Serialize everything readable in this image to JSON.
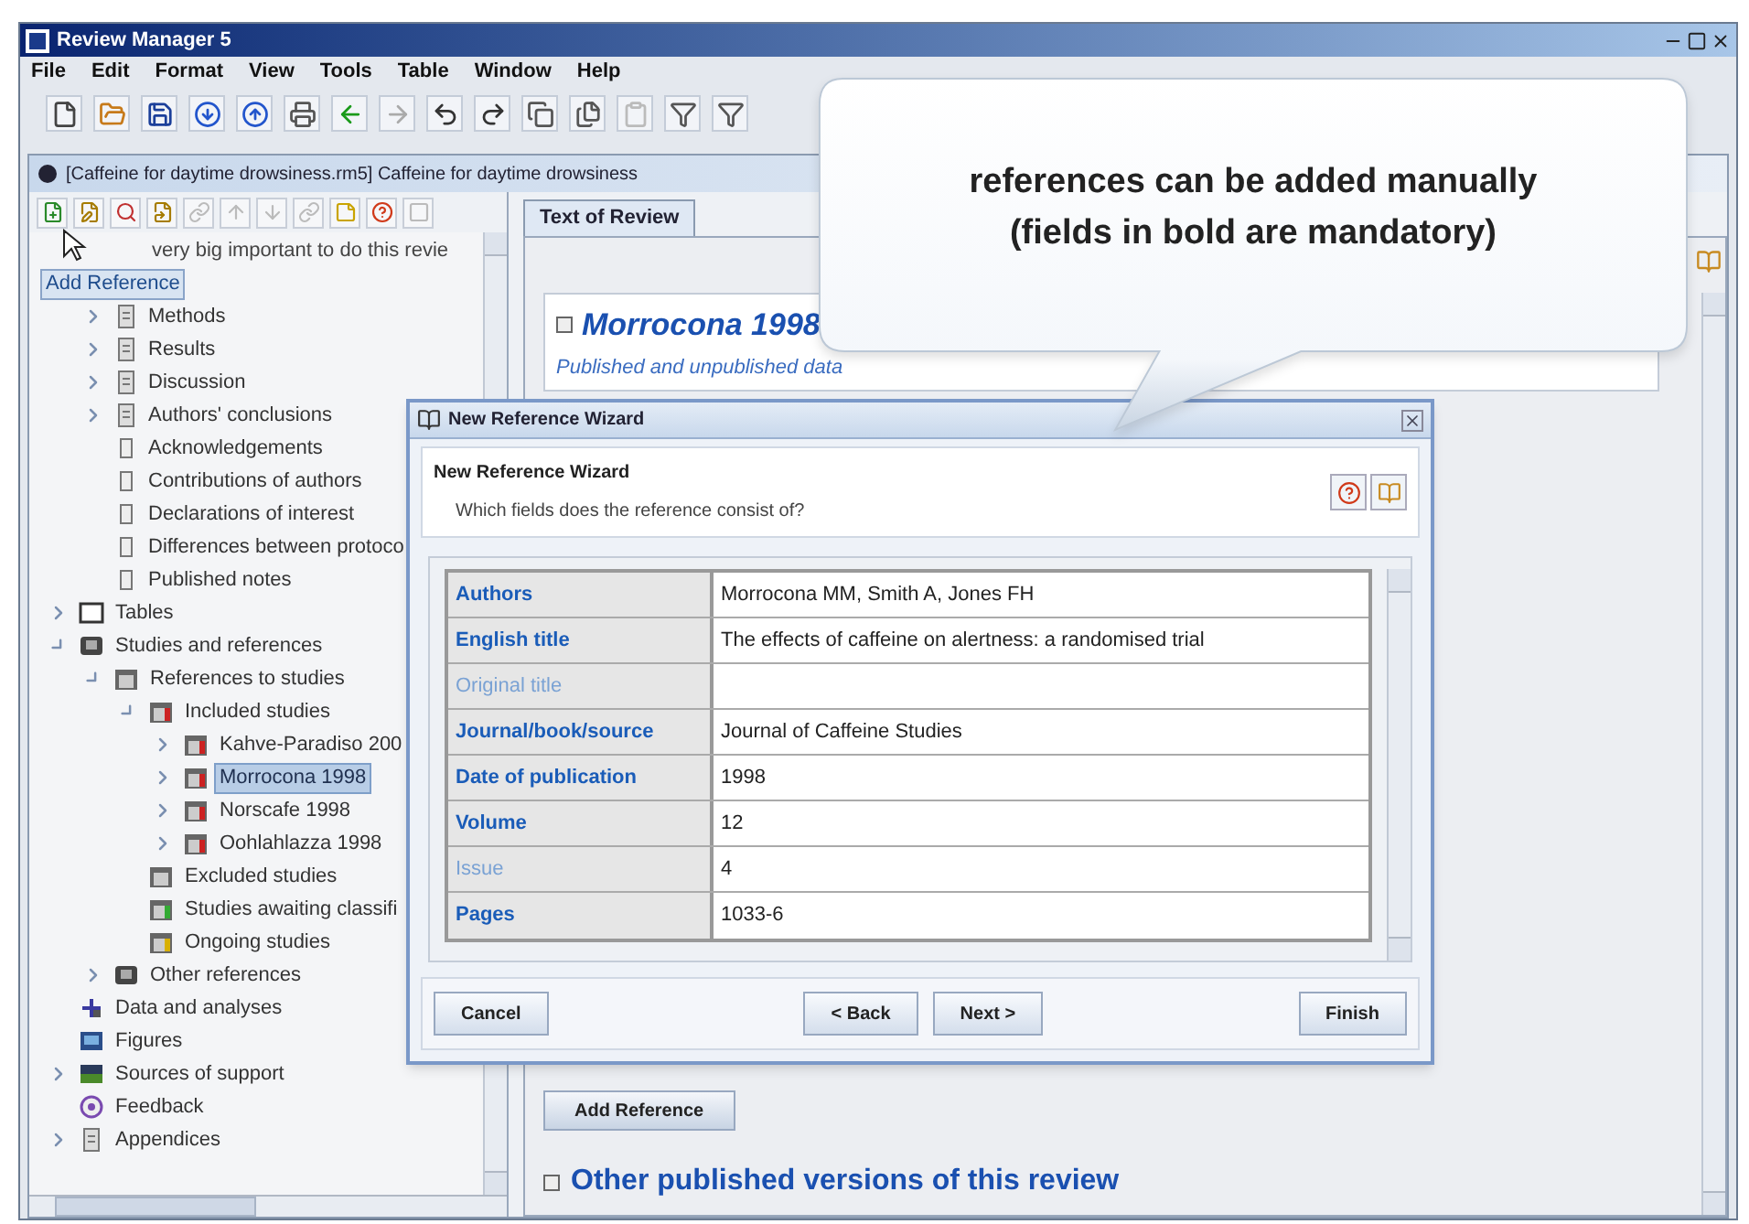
{
  "window": {
    "title": "Review Manager 5"
  },
  "menu": [
    "File",
    "Edit",
    "Format",
    "View",
    "Tools",
    "Table",
    "Window",
    "Help"
  ],
  "document": {
    "title": "[Caffeine for daytime drowsiness.rm5] Caffeine for daytime drowsiness"
  },
  "tree": {
    "partial_row": "very big important to do this revie",
    "tooltip": "Add Reference",
    "review_sections": [
      {
        "label": "Methods",
        "kind": "section",
        "expanded": false
      },
      {
        "label": "Results",
        "kind": "section",
        "expanded": false
      },
      {
        "label": "Discussion",
        "kind": "section",
        "expanded": false
      },
      {
        "label": "Authors' conclusions",
        "kind": "section",
        "expanded": false
      },
      {
        "label": "Acknowledgements",
        "kind": "page"
      },
      {
        "label": "Contributions of authors",
        "kind": "page"
      },
      {
        "label": "Declarations of interest",
        "kind": "page"
      },
      {
        "label": "Differences between protoco",
        "kind": "page"
      },
      {
        "label": "Published notes",
        "kind": "page"
      }
    ],
    "items": [
      {
        "label": "Tables",
        "kind": "table",
        "expanded": false,
        "selected": false
      },
      {
        "label": "Studies and references",
        "kind": "book",
        "expanded": true,
        "selected": false,
        "children": [
          {
            "label": "References to studies",
            "kind": "studies",
            "expanded": true,
            "selected": false,
            "children": [
              {
                "label": "Included studies",
                "kind": "study-red",
                "expanded": true,
                "selected": false,
                "children": [
                  {
                    "label": "Kahve-Paradiso 200",
                    "kind": "study-red",
                    "expanded": false,
                    "selected": false
                  },
                  {
                    "label": "Morrocona 1998",
                    "kind": "study-red",
                    "expanded": false,
                    "selected": true
                  },
                  {
                    "label": "Norscafe 1998",
                    "kind": "study-red",
                    "expanded": false,
                    "selected": false
                  },
                  {
                    "label": "Oohlahlazza 1998",
                    "kind": "study-red",
                    "expanded": false,
                    "selected": false
                  }
                ]
              },
              {
                "label": "Excluded studies",
                "kind": "studies",
                "selected": false
              },
              {
                "label": "Studies awaiting classifi",
                "kind": "study-green",
                "selected": false
              },
              {
                "label": "Ongoing studies",
                "kind": "study-yellow",
                "selected": false
              }
            ]
          },
          {
            "label": "Other references",
            "kind": "book",
            "expanded": false,
            "selected": false
          }
        ]
      },
      {
        "label": "Data and analyses",
        "kind": "data",
        "selected": false
      },
      {
        "label": "Figures",
        "kind": "figure",
        "selected": false
      },
      {
        "label": "Sources of support",
        "kind": "support",
        "expanded": false,
        "selected": false
      },
      {
        "label": "Feedback",
        "kind": "feedback",
        "selected": false
      },
      {
        "label": "Appendices",
        "kind": "section",
        "expanded": false,
        "selected": false
      }
    ]
  },
  "tabs": [
    {
      "label": "Text of Review",
      "selected": true
    }
  ],
  "content": {
    "heading": "Morrocona 1998",
    "subheading": "Published and unpublished data",
    "add_button": "Add Reference",
    "section_heading": "Other published versions of this review"
  },
  "dialog": {
    "title": "New Reference Wizard",
    "heading": "New Reference Wizard",
    "prompt": "Which fields does the reference consist of?",
    "fields": [
      {
        "label": "Authors",
        "mandatory": true,
        "value": "Morrocona MM, Smith A, Jones FH"
      },
      {
        "label": "English title",
        "mandatory": true,
        "value": "The effects of caffeine on alertness: a randomised trial"
      },
      {
        "label": "Original title",
        "mandatory": false
      },
      {
        "label": "Journal/book/source",
        "mandatory": true,
        "value": "Journal of Caffeine Studies"
      },
      {
        "label": "Date of publication",
        "mandatory": true,
        "value": "1998"
      },
      {
        "label": "Volume",
        "mandatory": true,
        "value": "12"
      },
      {
        "label": "Issue",
        "mandatory": false,
        "value": "4"
      },
      {
        "label": "Pages",
        "mandatory": true,
        "value": "1033-6"
      }
    ],
    "buttons": [
      "Cancel",
      "< Back",
      "Next >",
      "Finish"
    ]
  },
  "callout": {
    "lines": [
      "references can be added manually",
      "(fields in bold are mandatory)"
    ]
  }
}
